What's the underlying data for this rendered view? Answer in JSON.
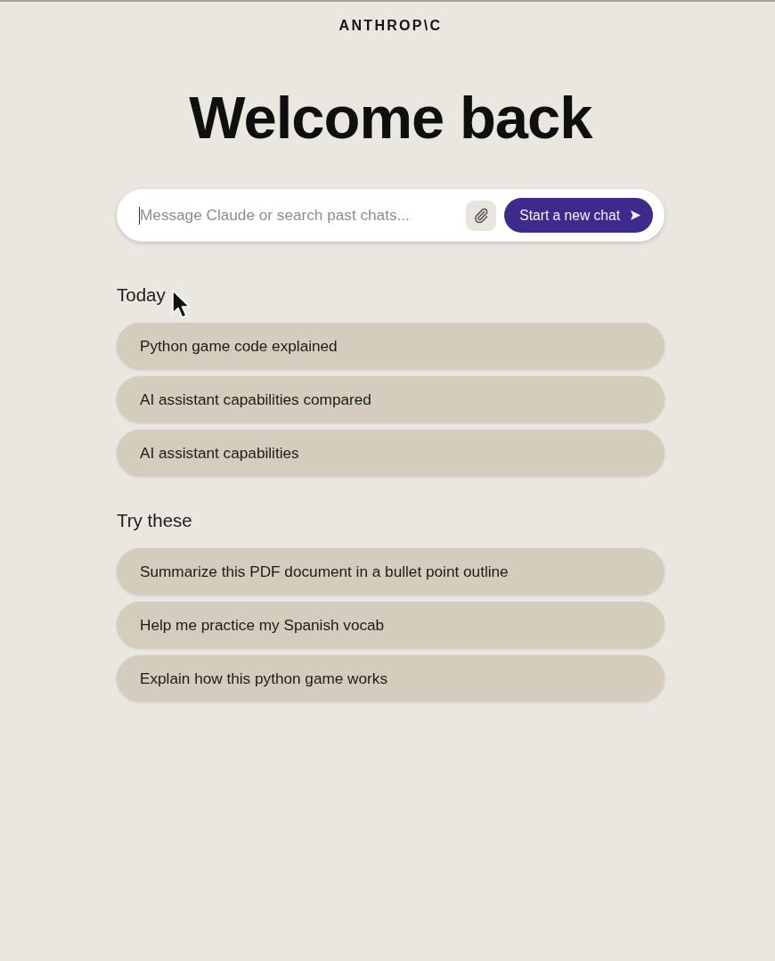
{
  "logo": "ANTHROP\\C",
  "heading": "Welcome back",
  "composer": {
    "placeholder": "Message Claude or search past chats...",
    "button": "Start a new chat"
  },
  "sections": [
    {
      "title": "Today",
      "items": [
        "Python game code explained",
        "AI assistant capabilities compared",
        "AI assistant capabilities"
      ]
    },
    {
      "title": "Try these",
      "items": [
        "Summarize this PDF document in a bullet point outline",
        "Help me practice my Spanish vocab",
        "Explain how this python game works"
      ]
    }
  ]
}
